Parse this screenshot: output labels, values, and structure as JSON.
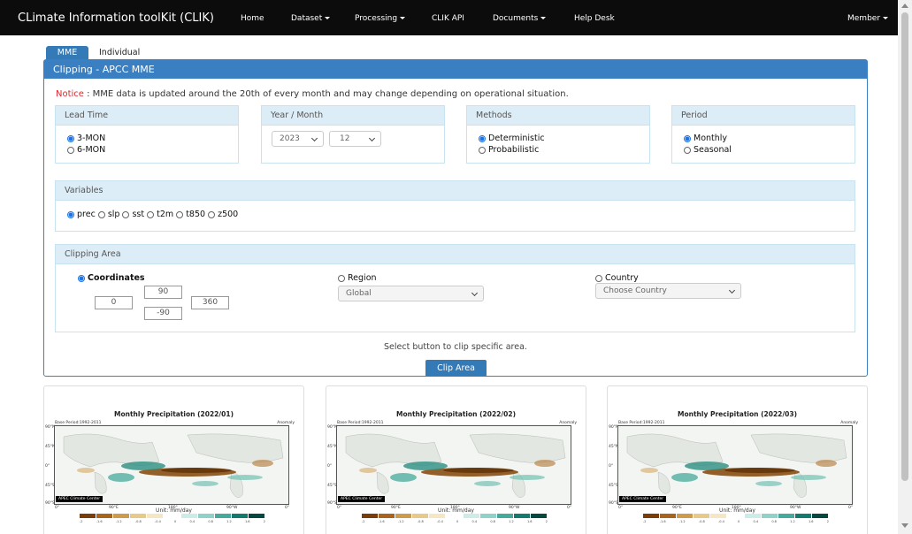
{
  "navbar": {
    "brand": "CLimate Information toolKit (CLIK)",
    "items": [
      {
        "label": "Home"
      },
      {
        "label": "Dataset"
      },
      {
        "label": "Processing"
      },
      {
        "label": "CLIK API"
      },
      {
        "label": "Documents"
      },
      {
        "label": "Help Desk"
      }
    ],
    "member": "Member"
  },
  "tabs": [
    {
      "label": "MME",
      "active": true
    },
    {
      "label": "Individual",
      "active": false
    }
  ],
  "panel": {
    "title": "Clipping - APCC MME",
    "notice_label": "Notice",
    "notice_text": " : MME data is updated around the 20th of every month and may change depending on operational situation."
  },
  "lead_time": {
    "heading": "Lead Time",
    "options": [
      {
        "label": "3-MON",
        "checked": true
      },
      {
        "label": "6-MON",
        "checked": false
      }
    ]
  },
  "year_month": {
    "heading": "Year / Month",
    "year": "2023",
    "month": "12"
  },
  "methods": {
    "heading": "Methods",
    "options": [
      {
        "label": "Deterministic",
        "checked": true
      },
      {
        "label": "Probabilistic",
        "checked": false
      }
    ]
  },
  "period": {
    "heading": "Period",
    "options": [
      {
        "label": "Monthly",
        "checked": true
      },
      {
        "label": "Seasonal",
        "checked": false
      }
    ]
  },
  "variables": {
    "heading": "Variables",
    "options": [
      {
        "label": "prec",
        "checked": true
      },
      {
        "label": "slp",
        "checked": false
      },
      {
        "label": "sst",
        "checked": false
      },
      {
        "label": "t2m",
        "checked": false
      },
      {
        "label": "t850",
        "checked": false
      },
      {
        "label": "z500",
        "checked": false
      }
    ]
  },
  "clipping_area": {
    "heading": "Clipping Area",
    "coordinates_label": "Coordinates",
    "coordinates_checked": true,
    "north": "90",
    "west": "0",
    "east": "360",
    "south": "-90",
    "region_label": "Region",
    "region_value": "Global",
    "country_label": "Country",
    "country_placeholder": "Choose Country"
  },
  "clip_hint": "Select button to clip specific area.",
  "clip_button": "Clip Area",
  "maps": [
    {
      "title": "Monthly  Precipitation (2022/01)"
    },
    {
      "title": "Monthly  Precipitation (2022/02)"
    },
    {
      "title": "Monthly  Precipitation (2022/03)"
    }
  ],
  "map_labels": {
    "base_period": "Base Period:1992-2011",
    "anomaly": "Anomaly",
    "apcc": "APEC Climate Center",
    "unit": "Unit: mm/day",
    "lat_labels": [
      "90°N",
      "45°N",
      "0°",
      "45°S",
      "90°S"
    ],
    "lon_labels": [
      "0°",
      "90°E",
      "180°",
      "90°W",
      "0°"
    ],
    "colorbar_ticks": [
      "-2",
      "-1.6",
      "-1.2",
      "-0.8",
      "-0.4",
      "0",
      "0.4",
      "0.8",
      "1.2",
      "1.6",
      "2"
    ]
  },
  "colors": {
    "navbar_bg": "#0c0c0c",
    "primary": "#337ab7",
    "notice": "#e0272d",
    "box_heading_bg": "#dcedf7",
    "colorbar": [
      "#7a3d0a",
      "#a8641c",
      "#cf9a4b",
      "#e8c98a",
      "#f5e7c4",
      "#ffffff",
      "#cdece8",
      "#8fd3c8",
      "#45a99c",
      "#127a6e",
      "#04483f"
    ]
  }
}
